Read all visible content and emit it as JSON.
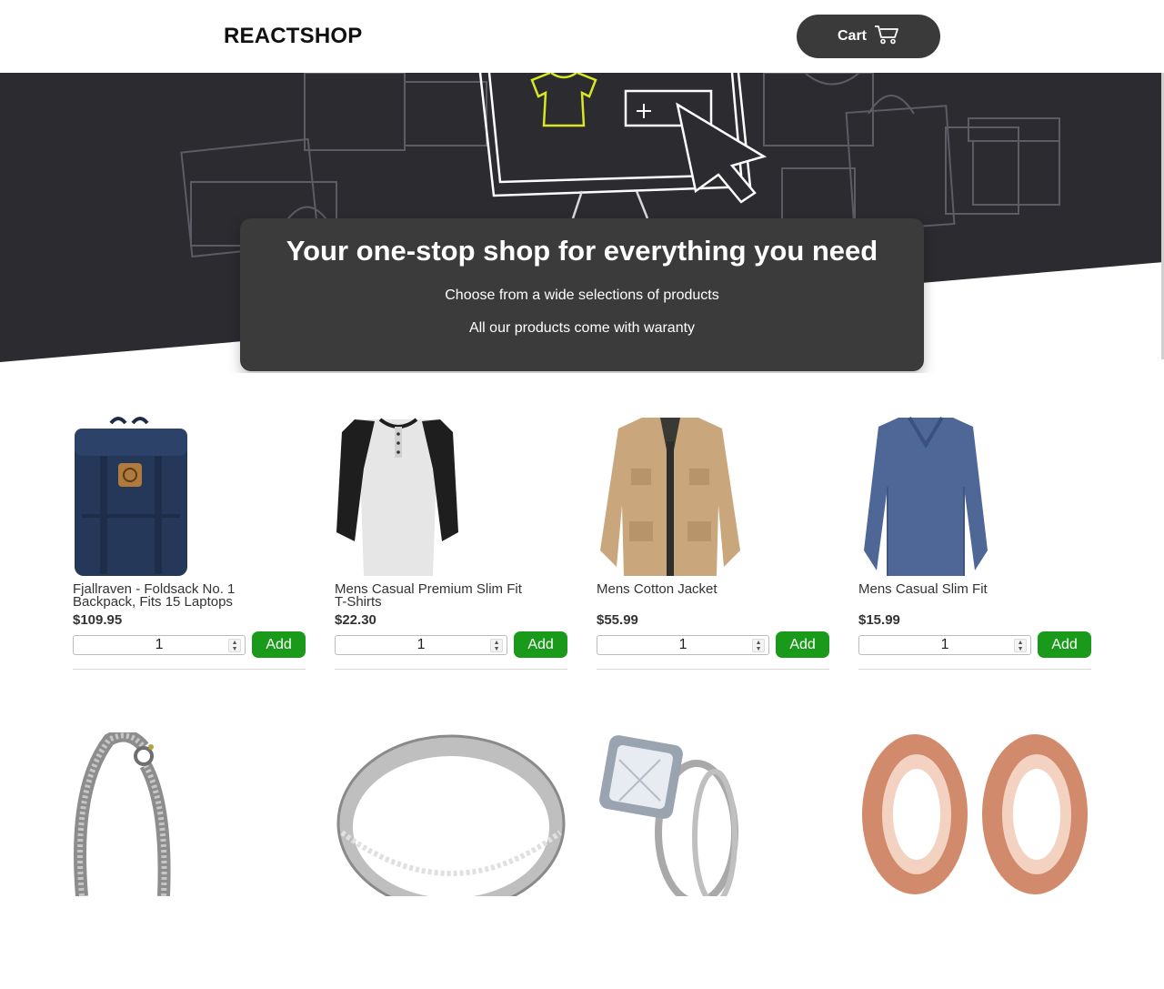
{
  "header": {
    "brand": "REACTSHOP",
    "cart_label": "Cart"
  },
  "hero": {
    "title": "Your one-stop shop for everything you need",
    "line1": "Choose from a wide selections of products",
    "line2": "All our products come with waranty"
  },
  "colors": {
    "hero_bg": "#2b2b30",
    "card_bg": "#3b3b3b",
    "add_green": "#1a9a1a",
    "cart_bg": "#3a3a3a"
  },
  "products": [
    {
      "title": "Fjallraven - Foldsack No. 1 Backpack, Fits 15 Laptops",
      "price": "$109.95",
      "qty": "1",
      "add": "Add",
      "image": "navy-backpack"
    },
    {
      "title": "Mens Casual Premium Slim Fit T-Shirts",
      "price": "$22.30",
      "qty": "1",
      "add": "Add",
      "image": "raglan-henley-shirt"
    },
    {
      "title": "Mens Cotton Jacket",
      "price": "$55.99",
      "qty": "1",
      "add": "Add",
      "image": "khaki-jacket"
    },
    {
      "title": "Mens Casual Slim Fit",
      "price": "$15.99",
      "qty": "1",
      "add": "Add",
      "image": "blue-long-sleeve"
    },
    {
      "title": "",
      "price": "",
      "qty": "",
      "add": "",
      "image": "dragon-bracelet"
    },
    {
      "title": "",
      "price": "",
      "qty": "",
      "add": "",
      "image": "silver-band-ring"
    },
    {
      "title": "",
      "price": "",
      "qty": "",
      "add": "",
      "image": "diamond-ring-set"
    },
    {
      "title": "",
      "price": "",
      "qty": "",
      "add": "",
      "image": "rose-gold-tunnels"
    }
  ]
}
